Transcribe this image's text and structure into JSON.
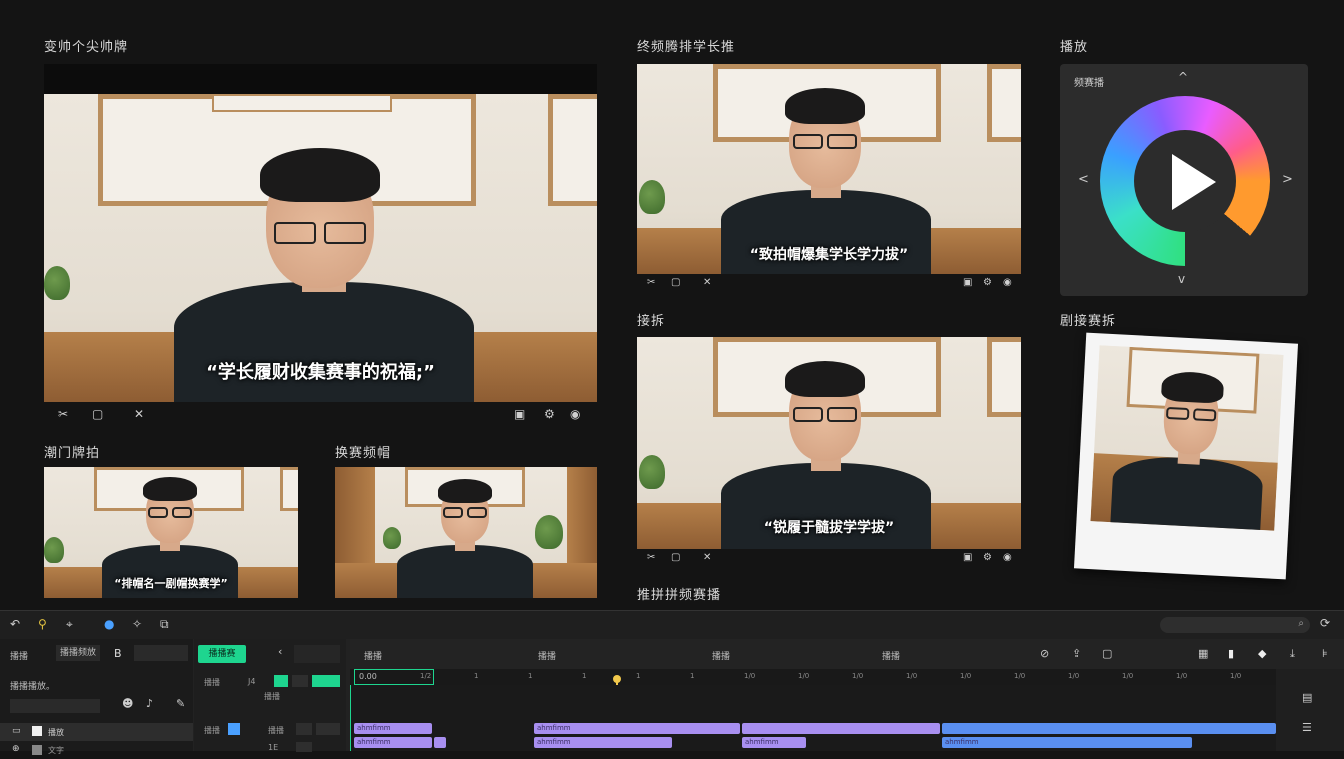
{
  "main_preview": {
    "title": "变帅个尖帅牌",
    "subtitle": "“学长履财收集赛事的祝福;”"
  },
  "top_right_preview": {
    "title": "终频腾排学长推",
    "subtitle": "“致拍帽爆集学长学力拔”"
  },
  "mid_right_preview": {
    "title": "接拆",
    "subtitle": "“锐履于髓拔学学拔”"
  },
  "small_left_preview": {
    "title": "潮门牌拍",
    "subtitle": "“排帽名一剧帽换赛学”"
  },
  "small_mid_preview": {
    "title": "换赛频帽"
  },
  "player_panel": {
    "title": "播放",
    "tag": "频赛播"
  },
  "photo_panel": {
    "title": "剧接赛拆"
  },
  "bottom_caption": "推拼拼频赛播",
  "toolbar": {
    "search_placeholder": ""
  },
  "editor": {
    "left_tab1": "播播",
    "left_tab2": "播播频放",
    "left_tab3": "B",
    "active_tab": "播播赛",
    "lane_labels": [
      "播播",
      "播播",
      "播播",
      "播播"
    ],
    "tracks_header": "播播播放。",
    "track1_label": "播放",
    "track2_label": "文字",
    "timecode": "0.00",
    "ruler": [
      "1/2",
      "1",
      "1",
      "1",
      "1",
      "1",
      "1/0",
      "1/0",
      "1/0",
      "1/0",
      "1/0",
      "1/0",
      "1/0",
      "1/0",
      "1/0",
      "1/0"
    ]
  },
  "colors": {
    "accent": "#1ed58f",
    "clip_purple": "#a88ff0",
    "clip_blue": "#5a8ff0",
    "playhead": "#f2c94c"
  }
}
